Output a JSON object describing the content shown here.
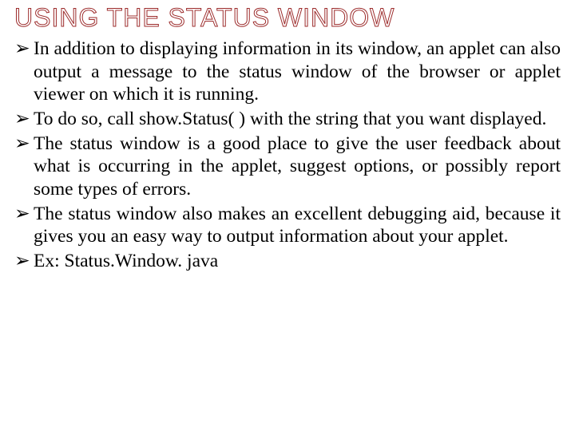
{
  "title": "USING THE STATUS WINDOW",
  "bullet_char": "➢",
  "items": [
    "In addition to displaying information in its window, an applet can also output a message to the status window of the browser or applet viewer on which it is running.",
    "To do so, call show.Status( ) with the string that you want displayed.",
    "The status window is a good place to give the user feedback about what is occurring in the applet, suggest options, or possibly report some types of errors.",
    "The status window also makes an excellent debugging aid, because it gives you an easy way to output information about your applet.",
    "Ex: Status.Window. java"
  ]
}
